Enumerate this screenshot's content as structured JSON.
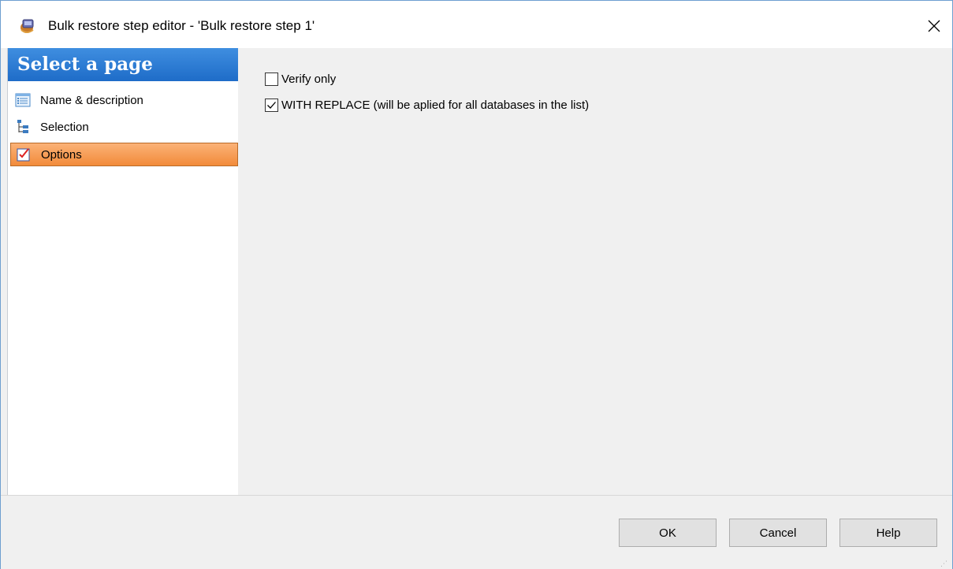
{
  "window": {
    "title": "Bulk restore step editor - 'Bulk restore step 1'",
    "close_glyph": "✕"
  },
  "sidebar": {
    "header": "Select a page",
    "items": [
      {
        "label": "Name & description",
        "icon": "list-document-icon",
        "active": false
      },
      {
        "label": "Selection",
        "icon": "tree-icon",
        "active": false
      },
      {
        "label": "Options",
        "icon": "checklist-icon",
        "active": true
      }
    ]
  },
  "options": {
    "verify_only": {
      "label": "Verify only",
      "checked": false
    },
    "with_replace": {
      "label": "WITH REPLACE (will be aplied for all databases in the list)",
      "checked": true
    }
  },
  "footer": {
    "ok_label": "OK",
    "cancel_label": "Cancel",
    "help_label": "Help"
  },
  "colors": {
    "header_blue": "#1e6cc8",
    "active_orange": "#f28b3a",
    "window_border": "#6e9fd0"
  }
}
